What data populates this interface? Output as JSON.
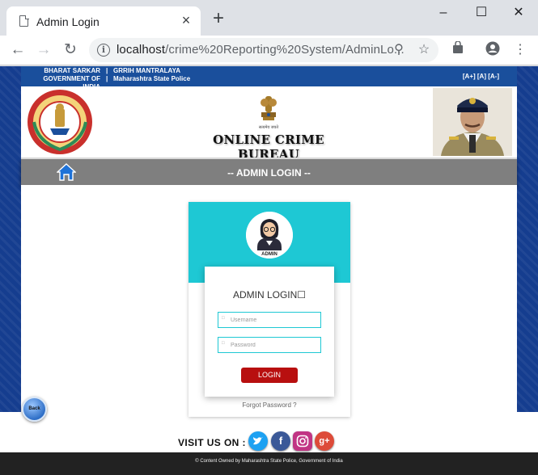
{
  "browser": {
    "tab_title": "Admin Login",
    "tab_close": "×",
    "new_tab": "+",
    "url_host": "localhost",
    "url_path": "/crime%20Reporting%20System/AdminLo...",
    "window_controls": [
      "–",
      "☐",
      "✕"
    ]
  },
  "page": {
    "top_strip": {
      "left_line1": "BHARAT SARKAR",
      "left_line2": "GOVERNMENT OF INDIA",
      "right_line1": "GRRIH MANTRALAYA",
      "right_line2": "Maharashtra State Police",
      "font_controls": "[A+] [A] [A-]"
    },
    "site_title": "ONLINE CRIME BUREAU",
    "emblem_caption": "सत्यमेव जयते",
    "nav_title": "-- ADMIN LOGIN --",
    "login_card": {
      "avatar_label": "ADMIN",
      "heading": "ADMIN LOGIN",
      "username_placeholder": "Username",
      "password_placeholder": "Password",
      "login_button": "LOGIN",
      "forgot_link": "Forgot Password ?"
    },
    "back_button": "Back",
    "visit_us": "VISIT US ON :",
    "social": [
      {
        "name": "twitter",
        "color": "#1da1f2"
      },
      {
        "name": "facebook",
        "color": "#3b5998"
      },
      {
        "name": "instagram",
        "color": "#c13584"
      },
      {
        "name": "google-plus",
        "color": "#dd4b39"
      }
    ],
    "footer_text": "Content Owned by Maharashtra State Police, Government of India"
  },
  "colors": {
    "header_blue": "#1a4f9c",
    "nav_gray": "#7f7f7f",
    "card_teal": "#1ec8d4",
    "login_red": "#b80f0f"
  }
}
